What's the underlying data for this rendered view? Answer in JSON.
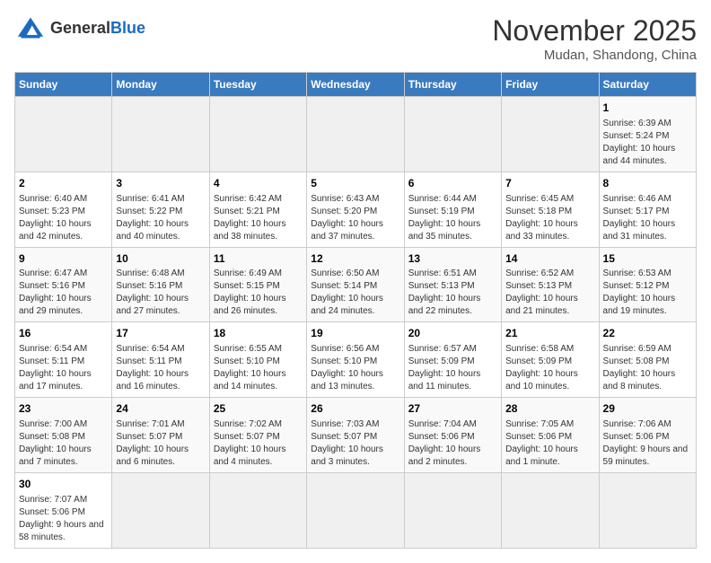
{
  "logo": {
    "text_general": "General",
    "text_blue": "Blue"
  },
  "calendar": {
    "title": "November 2025",
    "subtitle": "Mudan, Shandong, China"
  },
  "days_of_week": [
    "Sunday",
    "Monday",
    "Tuesday",
    "Wednesday",
    "Thursday",
    "Friday",
    "Saturday"
  ],
  "weeks": [
    [
      {
        "day": "",
        "info": ""
      },
      {
        "day": "",
        "info": ""
      },
      {
        "day": "",
        "info": ""
      },
      {
        "day": "",
        "info": ""
      },
      {
        "day": "",
        "info": ""
      },
      {
        "day": "",
        "info": ""
      },
      {
        "day": "1",
        "info": "Sunrise: 6:39 AM\nSunset: 5:24 PM\nDaylight: 10 hours and 44 minutes."
      }
    ],
    [
      {
        "day": "2",
        "info": "Sunrise: 6:40 AM\nSunset: 5:23 PM\nDaylight: 10 hours and 42 minutes."
      },
      {
        "day": "3",
        "info": "Sunrise: 6:41 AM\nSunset: 5:22 PM\nDaylight: 10 hours and 40 minutes."
      },
      {
        "day": "4",
        "info": "Sunrise: 6:42 AM\nSunset: 5:21 PM\nDaylight: 10 hours and 38 minutes."
      },
      {
        "day": "5",
        "info": "Sunrise: 6:43 AM\nSunset: 5:20 PM\nDaylight: 10 hours and 37 minutes."
      },
      {
        "day": "6",
        "info": "Sunrise: 6:44 AM\nSunset: 5:19 PM\nDaylight: 10 hours and 35 minutes."
      },
      {
        "day": "7",
        "info": "Sunrise: 6:45 AM\nSunset: 5:18 PM\nDaylight: 10 hours and 33 minutes."
      },
      {
        "day": "8",
        "info": "Sunrise: 6:46 AM\nSunset: 5:17 PM\nDaylight: 10 hours and 31 minutes."
      }
    ],
    [
      {
        "day": "9",
        "info": "Sunrise: 6:47 AM\nSunset: 5:16 PM\nDaylight: 10 hours and 29 minutes."
      },
      {
        "day": "10",
        "info": "Sunrise: 6:48 AM\nSunset: 5:16 PM\nDaylight: 10 hours and 27 minutes."
      },
      {
        "day": "11",
        "info": "Sunrise: 6:49 AM\nSunset: 5:15 PM\nDaylight: 10 hours and 26 minutes."
      },
      {
        "day": "12",
        "info": "Sunrise: 6:50 AM\nSunset: 5:14 PM\nDaylight: 10 hours and 24 minutes."
      },
      {
        "day": "13",
        "info": "Sunrise: 6:51 AM\nSunset: 5:13 PM\nDaylight: 10 hours and 22 minutes."
      },
      {
        "day": "14",
        "info": "Sunrise: 6:52 AM\nSunset: 5:13 PM\nDaylight: 10 hours and 21 minutes."
      },
      {
        "day": "15",
        "info": "Sunrise: 6:53 AM\nSunset: 5:12 PM\nDaylight: 10 hours and 19 minutes."
      }
    ],
    [
      {
        "day": "16",
        "info": "Sunrise: 6:54 AM\nSunset: 5:11 PM\nDaylight: 10 hours and 17 minutes."
      },
      {
        "day": "17",
        "info": "Sunrise: 6:54 AM\nSunset: 5:11 PM\nDaylight: 10 hours and 16 minutes."
      },
      {
        "day": "18",
        "info": "Sunrise: 6:55 AM\nSunset: 5:10 PM\nDaylight: 10 hours and 14 minutes."
      },
      {
        "day": "19",
        "info": "Sunrise: 6:56 AM\nSunset: 5:10 PM\nDaylight: 10 hours and 13 minutes."
      },
      {
        "day": "20",
        "info": "Sunrise: 6:57 AM\nSunset: 5:09 PM\nDaylight: 10 hours and 11 minutes."
      },
      {
        "day": "21",
        "info": "Sunrise: 6:58 AM\nSunset: 5:09 PM\nDaylight: 10 hours and 10 minutes."
      },
      {
        "day": "22",
        "info": "Sunrise: 6:59 AM\nSunset: 5:08 PM\nDaylight: 10 hours and 8 minutes."
      }
    ],
    [
      {
        "day": "23",
        "info": "Sunrise: 7:00 AM\nSunset: 5:08 PM\nDaylight: 10 hours and 7 minutes."
      },
      {
        "day": "24",
        "info": "Sunrise: 7:01 AM\nSunset: 5:07 PM\nDaylight: 10 hours and 6 minutes."
      },
      {
        "day": "25",
        "info": "Sunrise: 7:02 AM\nSunset: 5:07 PM\nDaylight: 10 hours and 4 minutes."
      },
      {
        "day": "26",
        "info": "Sunrise: 7:03 AM\nSunset: 5:07 PM\nDaylight: 10 hours and 3 minutes."
      },
      {
        "day": "27",
        "info": "Sunrise: 7:04 AM\nSunset: 5:06 PM\nDaylight: 10 hours and 2 minutes."
      },
      {
        "day": "28",
        "info": "Sunrise: 7:05 AM\nSunset: 5:06 PM\nDaylight: 10 hours and 1 minute."
      },
      {
        "day": "29",
        "info": "Sunrise: 7:06 AM\nSunset: 5:06 PM\nDaylight: 9 hours and 59 minutes."
      }
    ],
    [
      {
        "day": "30",
        "info": "Sunrise: 7:07 AM\nSunset: 5:06 PM\nDaylight: 9 hours and 58 minutes."
      },
      {
        "day": "",
        "info": ""
      },
      {
        "day": "",
        "info": ""
      },
      {
        "day": "",
        "info": ""
      },
      {
        "day": "",
        "info": ""
      },
      {
        "day": "",
        "info": ""
      },
      {
        "day": "",
        "info": ""
      }
    ]
  ]
}
